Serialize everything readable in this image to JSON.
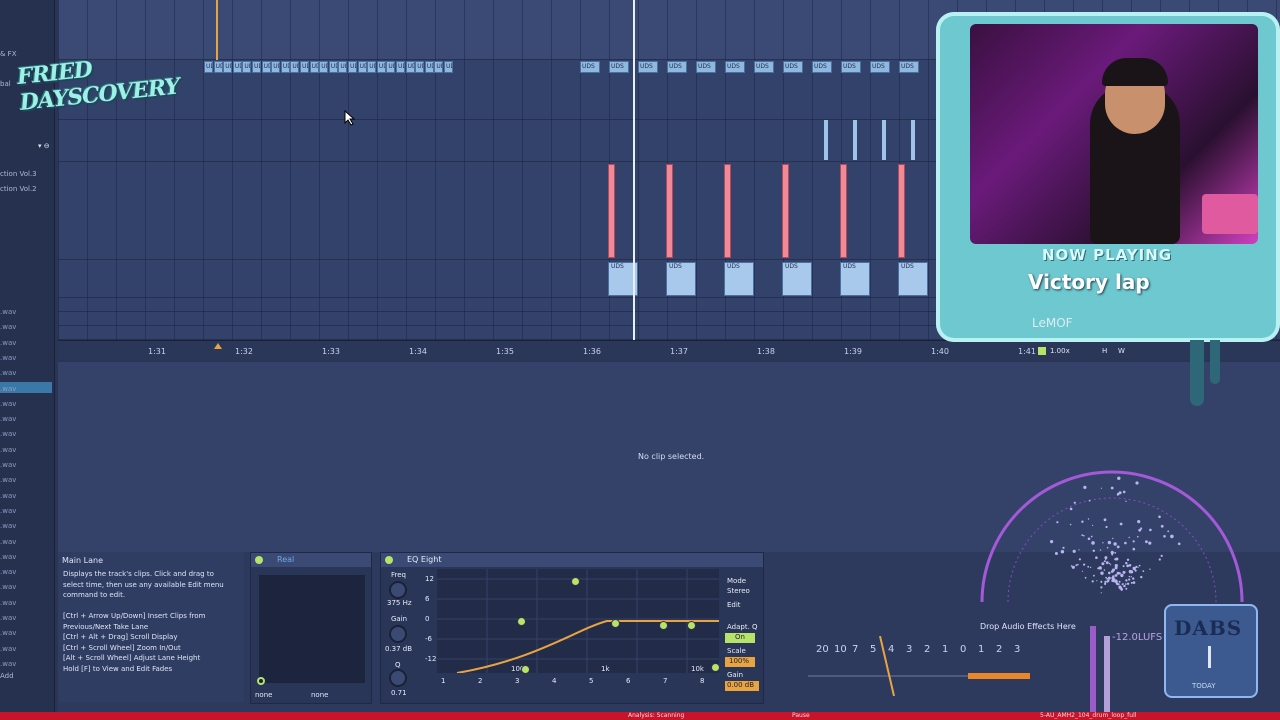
{
  "browser": {
    "top_labels": [
      "& FX",
      "bal",
      "ction Vol.3",
      "ction Vol.2"
    ],
    "files": [
      ".wav",
      ".wav",
      ".wav",
      ".wav",
      ".wav",
      ".wav",
      ".wav",
      ".wav",
      ".wav",
      ".wav",
      ".wav",
      ".wav",
      ".wav",
      ".wav",
      ".wav",
      ".wav",
      ".wav",
      ".wav",
      ".wav",
      ".wav",
      ".wav",
      ".wav",
      ".wav",
      ".wav"
    ],
    "bottom_label": "Add"
  },
  "logo": {
    "text": "FRIED DAYSCOVERY"
  },
  "arrangement": {
    "clip_label": "UDS",
    "ruler_ticks": [
      "1:31",
      "1:32",
      "1:33",
      "1:34",
      "1:35",
      "1:36",
      "1:37",
      "1:38",
      "1:39",
      "1:40",
      "1:41"
    ],
    "zoom_label": "1.00x",
    "loop_flags": [
      "H",
      "W"
    ]
  },
  "detail": {
    "message": "No clip selected."
  },
  "info_panel": {
    "title": "Main Lane",
    "lines": [
      "Displays the track's clips. Click and drag to",
      "select time, then use any available Edit menu",
      "command to edit.",
      "",
      "[Ctrl + Arrow Up/Down] Insert Clips from",
      "Previous/Next Take Lane",
      "[Ctrl + Alt + Drag] Scroll Display",
      "[Ctrl + Scroll Wheel] Zoom In/Out",
      "[Alt + Scroll Wheel] Adjust Lane Height",
      "Hold [F] to View and Edit Fades"
    ]
  },
  "device1": {
    "name": "Real",
    "dropdown_left": "none",
    "dropdown_right": "none"
  },
  "eq": {
    "name": "EQ Eight",
    "freq_label": "Freq",
    "freq_value": "375 Hz",
    "gain_label": "Gain",
    "gain_value": "0.37 dB",
    "q_label": "Q",
    "q_value": "0.71",
    "db_scale": [
      "12",
      "6",
      "0",
      "-6",
      "-12"
    ],
    "freq_scale": [
      "100",
      "1k",
      "10k"
    ],
    "mode_label": "Mode",
    "mode_value": "Stereo",
    "edit_label": "Edit",
    "adapt_label": "Adapt. Q",
    "adapt_value": "On",
    "scale_label": "Scale",
    "scale_value": "100%",
    "gain_out_label": "Gain",
    "gain_out_value": "0.00 dB",
    "bands": [
      "1",
      "2",
      "3",
      "4",
      "5",
      "6",
      "7",
      "8"
    ],
    "curve_color": "#e8a440",
    "node_color": "#b6e36a"
  },
  "overlay": {
    "now_playing_label": "NOW PLAYING",
    "track_title": "Victory lap",
    "artist": "LeMOF"
  },
  "meter": {
    "scale": [
      "20",
      "10",
      "7",
      "5",
      "4",
      "3",
      "2",
      "1",
      "0",
      "1",
      "2",
      "3"
    ],
    "drop_effects": "Drop Audio Effects Here",
    "lufs": "-12.0LUFS"
  },
  "badge": {
    "text": "DABS",
    "subtitle": "TODAY"
  },
  "statusbar": {
    "analysis": "Analysis: Scanning",
    "pause": "Pause",
    "filename": "5-AU_AMH2_104_drum_loop_full"
  }
}
